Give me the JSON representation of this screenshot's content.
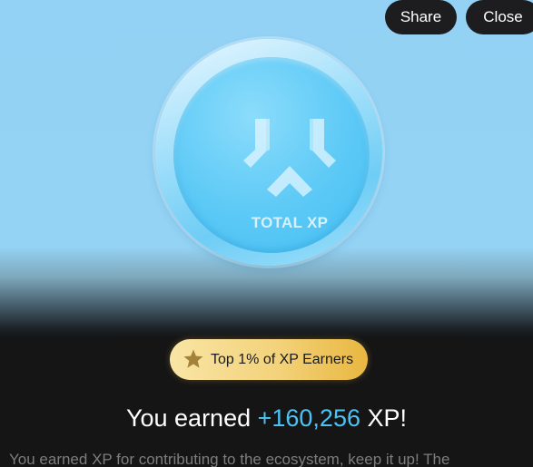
{
  "header": {
    "share_label": "Share",
    "close_label": "Close"
  },
  "coin": {
    "label": "TOTAL XP",
    "icon": "xp-logo-icon"
  },
  "badge": {
    "icon": "star-icon",
    "text": "Top 1% of XP Earners"
  },
  "headline": {
    "prefix": "You earned ",
    "amount": "+160,256",
    "suffix": " XP!"
  },
  "subtext": "You earned XP for contributing to the ecosystem, keep it up! The",
  "colors": {
    "sky": "#93d2f4",
    "background": "#151515",
    "accent": "#4cc3f5",
    "badge_gold": "#f3d27a",
    "button_dark": "#1d1d1f"
  }
}
